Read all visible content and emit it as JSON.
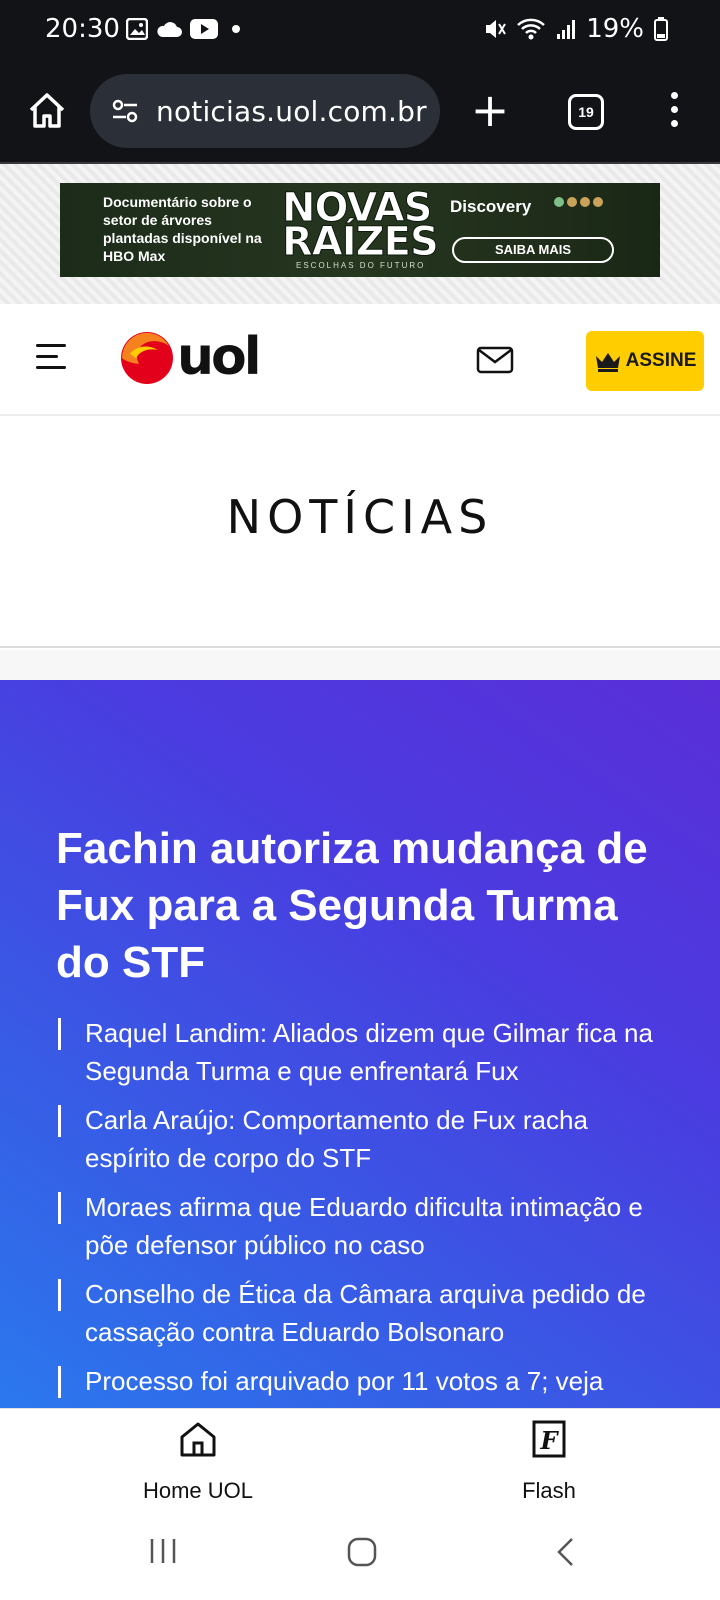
{
  "status_bar": {
    "time": "20:30",
    "battery": "19%",
    "icons": [
      "image-icon",
      "cloud-icon",
      "youtube-icon",
      "dot-icon",
      "mute-icon",
      "wifi-icon",
      "signal-icon",
      "battery-icon"
    ]
  },
  "browser": {
    "url": "noticias.uol.com.br",
    "tab_count": "19",
    "icons": [
      "home-icon",
      "site-settings-icon",
      "new-tab-icon",
      "tabs-icon",
      "more-icon"
    ]
  },
  "ad": {
    "left_text": "Documentário sobre o setor de árvores plantadas disponível na HBO Max",
    "title_line1": "NOVAS",
    "title_line2": "RAÍZES",
    "subtitle": "ESCOLHAS DO FUTURO",
    "brand": "Discovery",
    "cta": "SAIBA MAIS"
  },
  "header": {
    "logo_text": "uol",
    "assine_label": "ASSINE",
    "colors": {
      "accent": "#ffcd00",
      "logo_orange": "#f5821f",
      "logo_red": "#e3001b"
    }
  },
  "section": {
    "title": "NOTÍCIAS"
  },
  "hero": {
    "headline": "Fachin autoriza mudança de Fux para a Segunda Turma do STF",
    "related": [
      "Raquel Landim: Aliados dizem que Gilmar fica na Segunda Turma e que enfrentará Fux",
      "Carla Araújo: Comportamento de Fux racha espírito de corpo do STF",
      "Moraes afirma que Eduardo dificulta intimação e põe defensor público no caso",
      "Conselho de Ética da Câmara arquiva pedido de cassação contra Eduardo Bolsonaro",
      "Processo foi arquivado por 11 votos a 7; veja"
    ],
    "colors": {
      "gradient_top": "#5a2ed8",
      "gradient_bottom": "#2b78ee"
    }
  },
  "bottom_nav": {
    "items": [
      {
        "label": "Home UOL",
        "icon": "home-icon"
      },
      {
        "label": "Flash",
        "icon": "flash-f-icon"
      }
    ]
  }
}
